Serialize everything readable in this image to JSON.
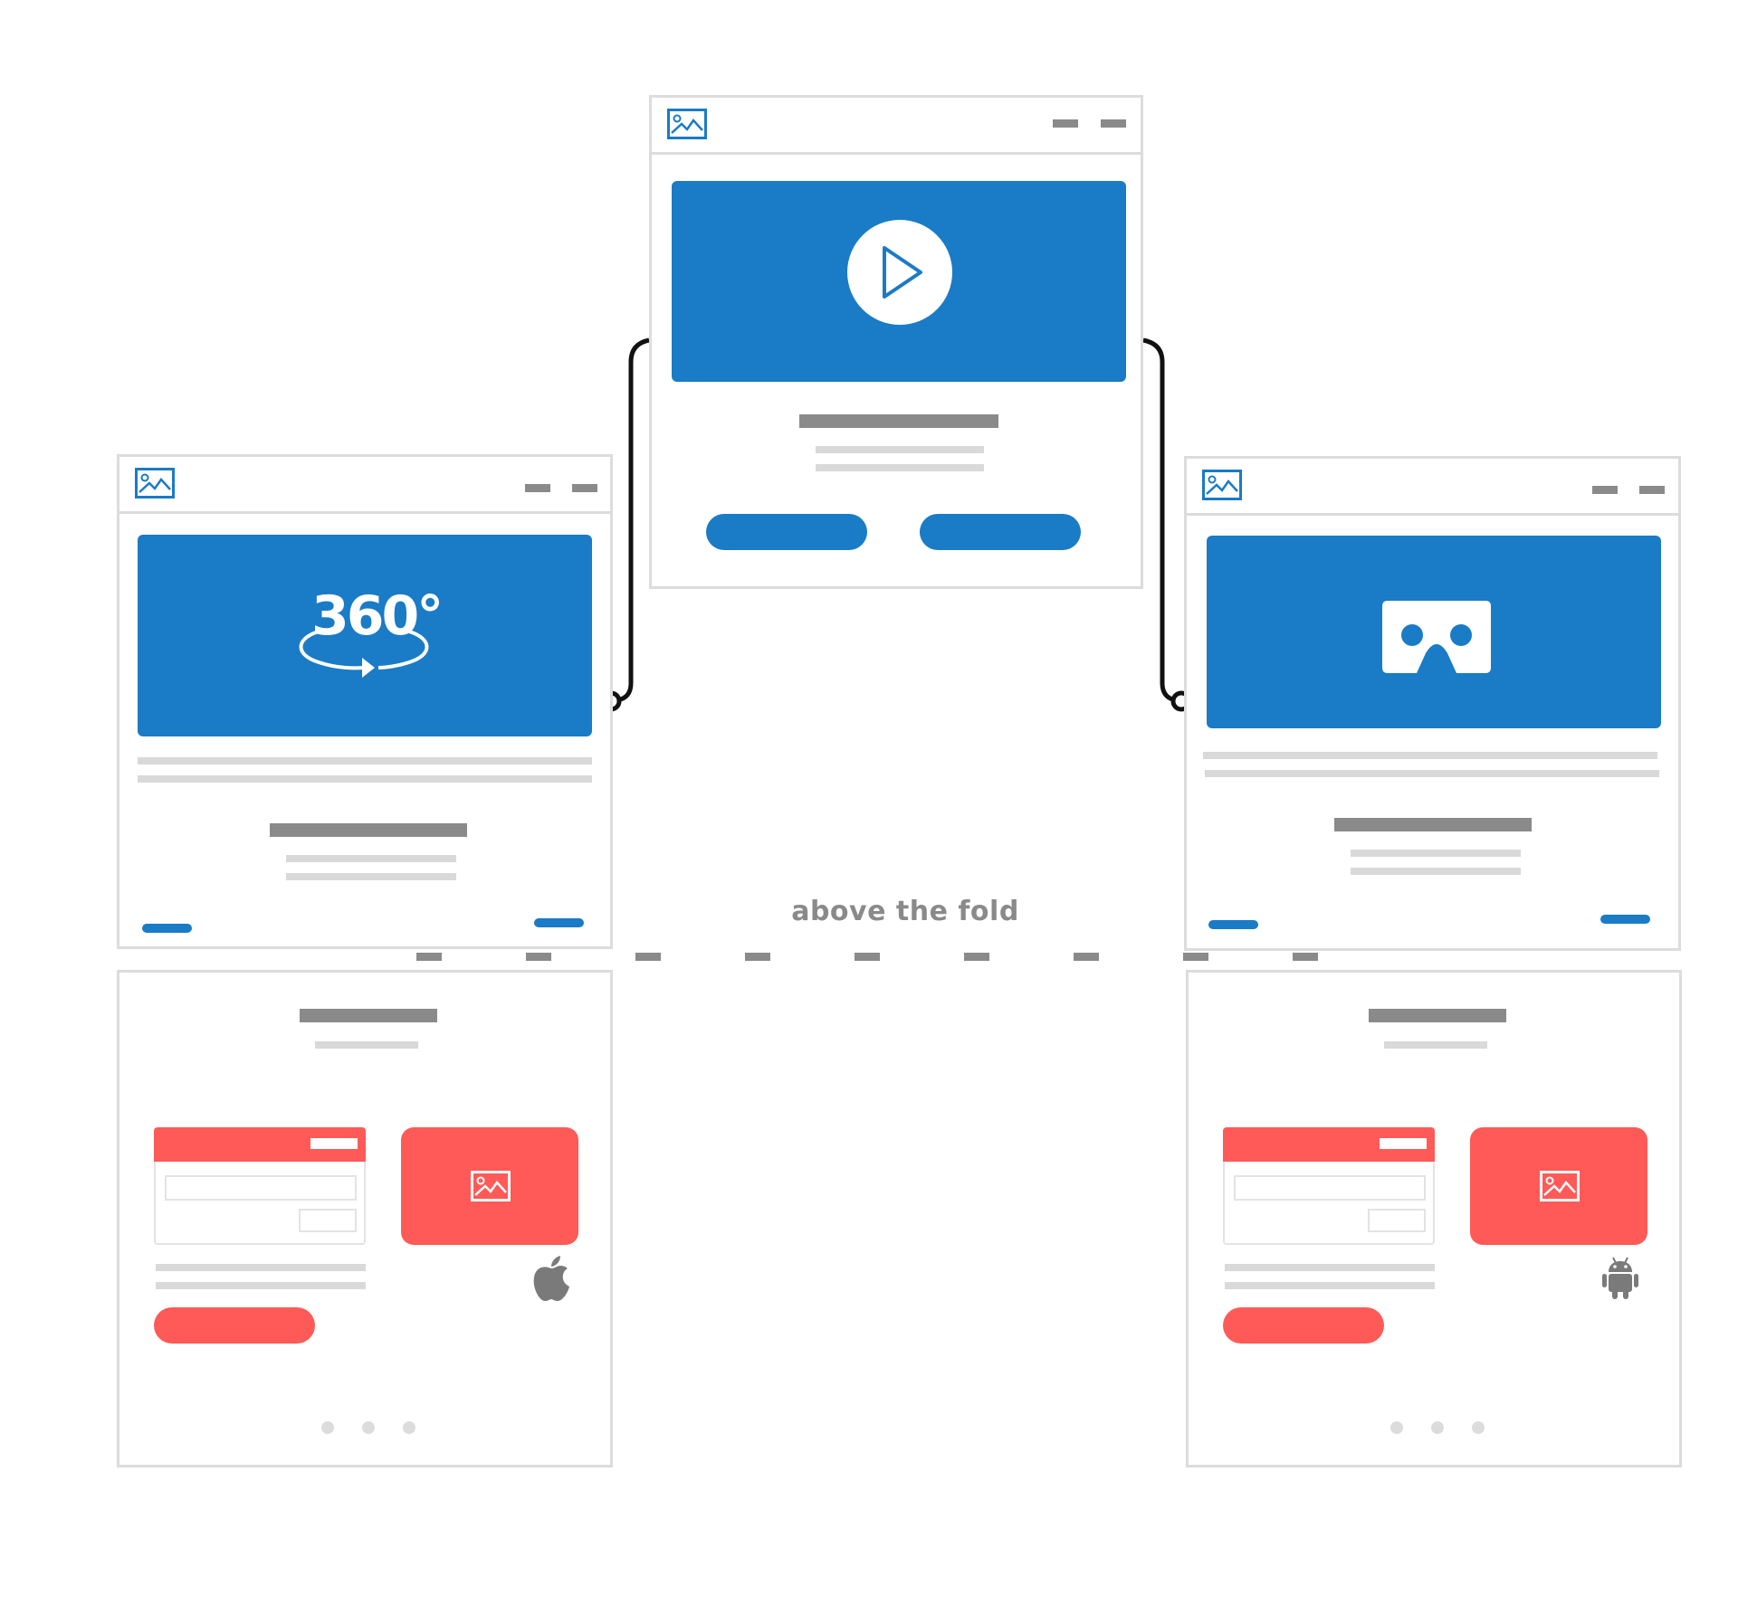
{
  "annotation": {
    "fold_label": "above the fold"
  },
  "hero_labels": {
    "panorama": "360°"
  },
  "colors": {
    "primary_blue": "#1a7bc6",
    "accent_red": "#ff5a57",
    "frame_gray": "#dcdcdc",
    "placeholder_dark": "#8a8a8a",
    "placeholder_light": "#d9d9d9",
    "connector": "#111111"
  },
  "icons": {
    "video": "play-icon",
    "panorama": "360-degree-icon",
    "vr": "vr-headset-icon",
    "ios": "apple-icon",
    "android": "android-icon",
    "image": "image-placeholder-icon"
  }
}
